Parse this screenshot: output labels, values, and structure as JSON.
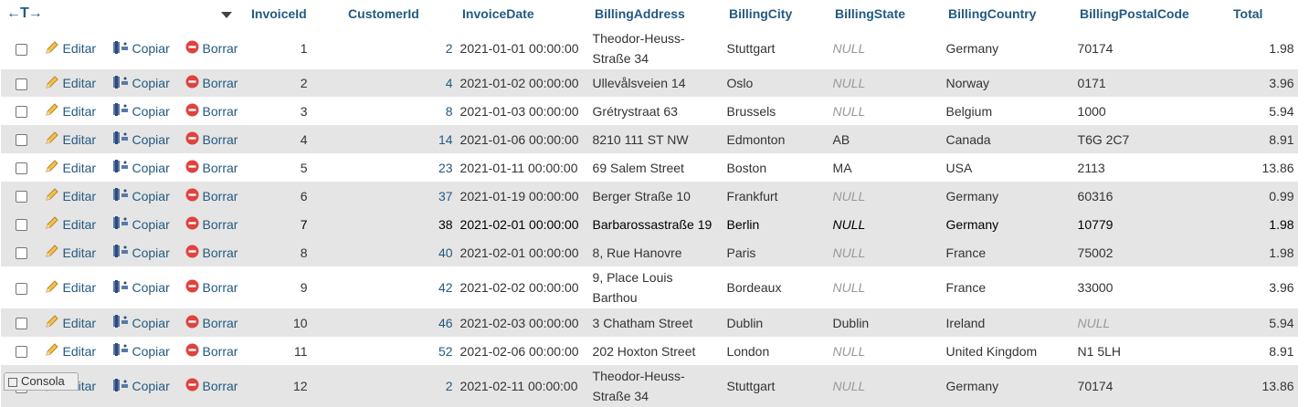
{
  "header": {
    "nav_arrows": "←T→",
    "columns": [
      "InvoiceId",
      "CustomerId",
      "InvoiceDate",
      "BillingAddress",
      "BillingCity",
      "BillingState",
      "BillingCountry",
      "BillingPostalCode",
      "Total"
    ]
  },
  "actions": {
    "edit": "Editar",
    "copy": "Copiar",
    "delete": "Borrar"
  },
  "rows": [
    {
      "id": "1",
      "customer": "2",
      "date": "2021-01-01 00:00:00",
      "address": "Theodor-Heuss-Straße 34",
      "city": "Stuttgart",
      "state": "NULL",
      "country": "Germany",
      "postal": "70174",
      "total": "1.98"
    },
    {
      "id": "2",
      "customer": "4",
      "date": "2021-01-02 00:00:00",
      "address": "Ullevålsveien 14",
      "city": "Oslo",
      "state": "NULL",
      "country": "Norway",
      "postal": "0171",
      "total": "3.96"
    },
    {
      "id": "3",
      "customer": "8",
      "date": "2021-01-03 00:00:00",
      "address": "Grétrystraat 63",
      "city": "Brussels",
      "state": "NULL",
      "country": "Belgium",
      "postal": "1000",
      "total": "5.94"
    },
    {
      "id": "4",
      "customer": "14",
      "date": "2021-01-06 00:00:00",
      "address": "8210 111 ST NW",
      "city": "Edmonton",
      "state": "AB",
      "country": "Canada",
      "postal": "T6G 2C7",
      "total": "8.91"
    },
    {
      "id": "5",
      "customer": "23",
      "date": "2021-01-11 00:00:00",
      "address": "69 Salem Street",
      "city": "Boston",
      "state": "MA",
      "country": "USA",
      "postal": "2113",
      "total": "13.86"
    },
    {
      "id": "6",
      "customer": "37",
      "date": "2021-01-19 00:00:00",
      "address": "Berger Straße 10",
      "city": "Frankfurt",
      "state": "NULL",
      "country": "Germany",
      "postal": "60316",
      "total": "0.99"
    },
    {
      "id": "7",
      "customer": "38",
      "date": "2021-02-01 00:00:00",
      "address": "Barbarossastraße 19",
      "city": "Berlin",
      "state": "NULL",
      "country": "Germany",
      "postal": "10779",
      "total": "1.98"
    },
    {
      "id": "8",
      "customer": "40",
      "date": "2021-02-01 00:00:00",
      "address": "8, Rue Hanovre",
      "city": "Paris",
      "state": "NULL",
      "country": "France",
      "postal": "75002",
      "total": "1.98"
    },
    {
      "id": "9",
      "customer": "42",
      "date": "2021-02-02 00:00:00",
      "address": "9, Place Louis Barthou",
      "city": "Bordeaux",
      "state": "NULL",
      "country": "France",
      "postal": "33000",
      "total": "3.96"
    },
    {
      "id": "10",
      "customer": "46",
      "date": "2021-02-03 00:00:00",
      "address": "3 Chatham Street",
      "city": "Dublin",
      "state": "Dublin",
      "country": "Ireland",
      "postal": "NULL",
      "total": "5.94"
    },
    {
      "id": "11",
      "customer": "52",
      "date": "2021-02-06 00:00:00",
      "address": "202 Hoxton Street",
      "city": "London",
      "state": "NULL",
      "country": "United Kingdom",
      "postal": "N1 5LH",
      "total": "8.91"
    },
    {
      "id": "12",
      "customer": "2",
      "date": "2021-02-11 00:00:00",
      "address": "Theodor-Heuss-Straße 34",
      "city": "Stuttgart",
      "state": "NULL",
      "country": "Germany",
      "postal": "70174",
      "total": "13.86"
    }
  ],
  "console": {
    "label": "Consola"
  },
  "colors": {
    "link": "#235a81",
    "row_alt": "#e5e5e5",
    "null_text": "#999999",
    "delete_icon": "#e0423e"
  }
}
